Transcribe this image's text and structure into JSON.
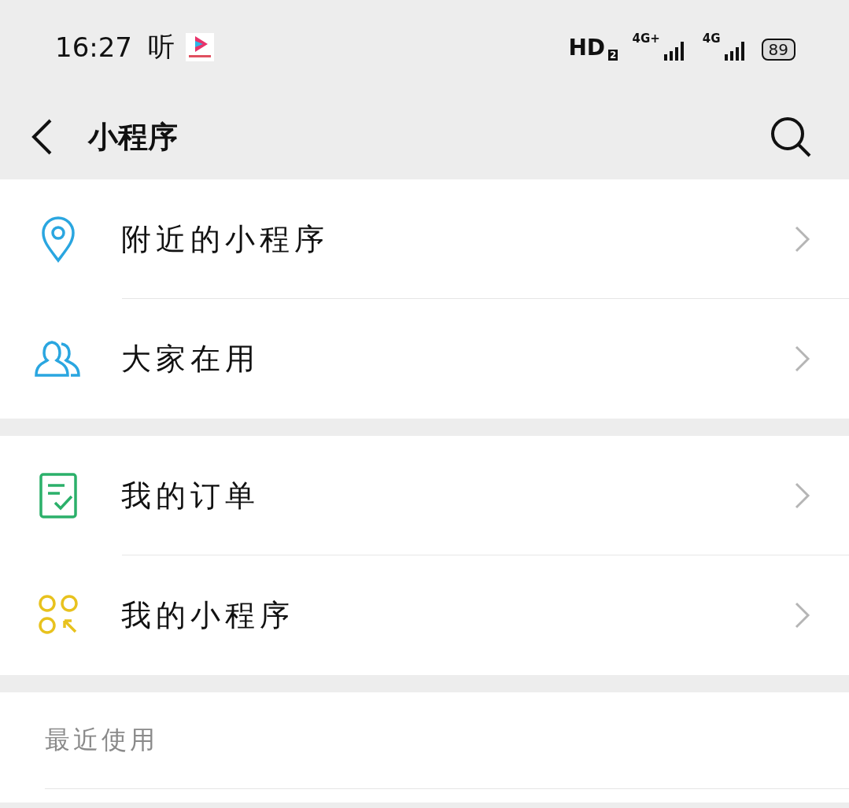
{
  "status_bar": {
    "time": "16:27",
    "listen": "听",
    "hd": "HD",
    "hd_sub": "2",
    "sim1": "4G+",
    "sim2": "4G",
    "battery": "89"
  },
  "header": {
    "title": "小程序"
  },
  "groups": [
    {
      "items": [
        {
          "label": "附近的小程序"
        },
        {
          "label": "大家在用"
        }
      ]
    },
    {
      "items": [
        {
          "label": "我的订单"
        },
        {
          "label": "我的小程序"
        }
      ]
    }
  ],
  "recent": {
    "heading": "最近使用"
  }
}
